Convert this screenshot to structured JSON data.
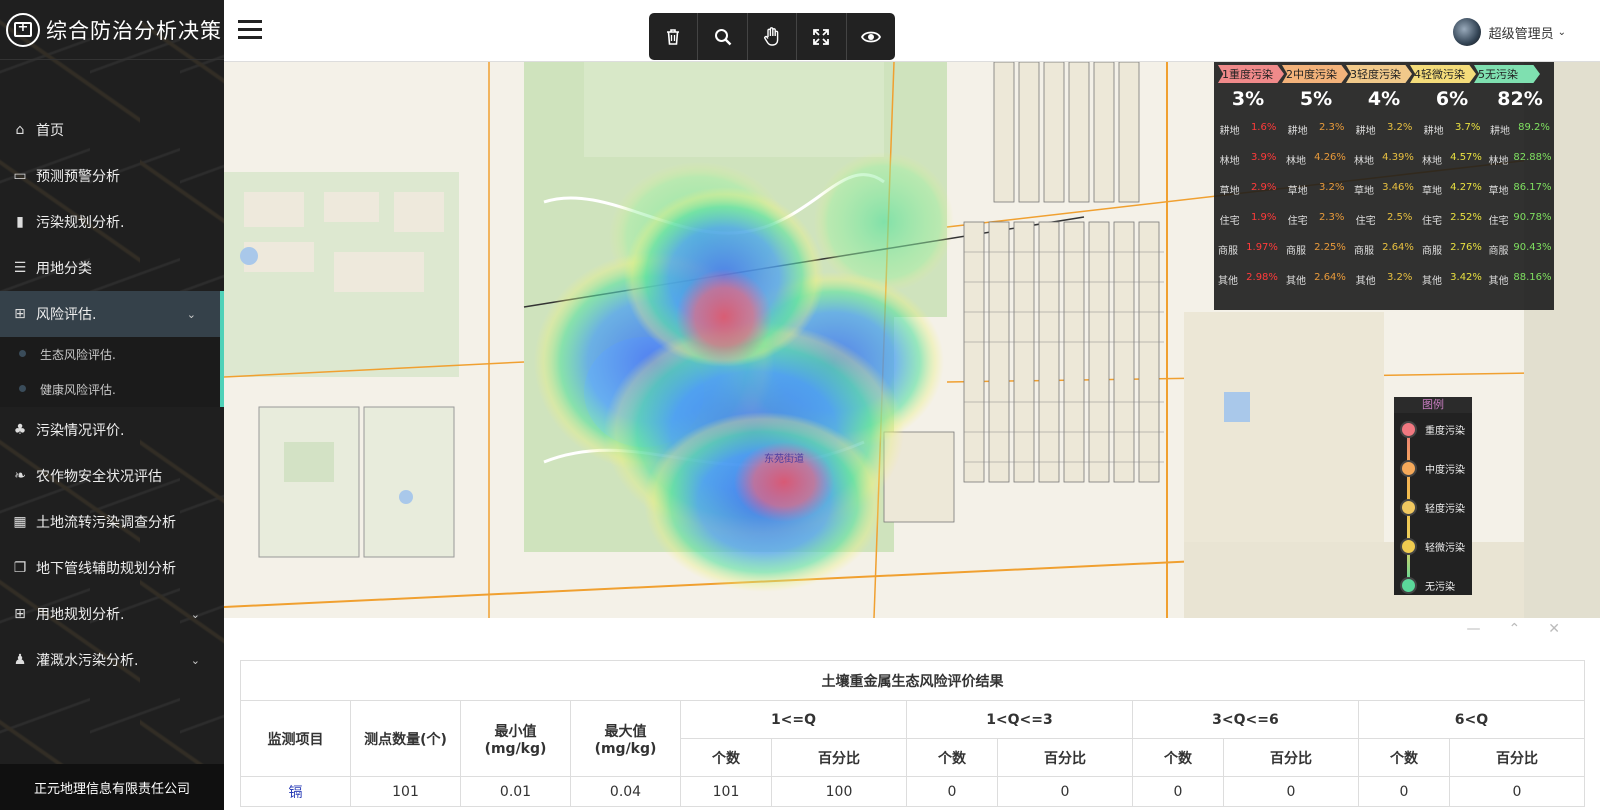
{
  "app": {
    "title": "综合防治分析决策",
    "company": "正元地理信息有限责任公司"
  },
  "sidebar": {
    "items": [
      {
        "label": "首页",
        "icon": "home-icon"
      },
      {
        "label": "预测预警分析",
        "icon": "monitor-icon"
      },
      {
        "label": "污染规划分析.",
        "icon": "bar-chart-icon"
      },
      {
        "label": "用地分类",
        "icon": "list-icon"
      },
      {
        "label": "风险评估.",
        "icon": "plus-square-icon",
        "active": true,
        "expanded": true
      },
      {
        "label": "污染情况评价.",
        "icon": "tree-icon"
      },
      {
        "label": "农作物安全状况评估",
        "icon": "leaf-icon"
      },
      {
        "label": "土地流转污染调查分析",
        "icon": "table-icon"
      },
      {
        "label": "地下管线辅助规划分析",
        "icon": "copy-icon"
      },
      {
        "label": "用地规划分析.",
        "icon": "plus-square-icon"
      },
      {
        "label": "灌溉水污染分析.",
        "icon": "person-icon"
      }
    ],
    "subitems": [
      "生态风险评估.",
      "健康风险评估."
    ]
  },
  "header": {
    "user": "超级管理员"
  },
  "toolbar": [
    "trash-icon",
    "search-icon",
    "hand-icon",
    "fullscreen-icon",
    "eye-icon"
  ],
  "stats": {
    "levels": [
      {
        "label": "1重度污染",
        "pct": "3%",
        "color": "#f08a8a"
      },
      {
        "label": "2中度污染",
        "pct": "5%",
        "color": "#f3b27a"
      },
      {
        "label": "3轻度污染",
        "pct": "4%",
        "color": "#f1c98a"
      },
      {
        "label": "4轻微污染",
        "pct": "6%",
        "color": "#f4dc7a"
      },
      {
        "label": "5无污染",
        "pct": "82%",
        "color": "#7fe0b0"
      }
    ],
    "value_colors": [
      "#ff3b3b",
      "#e89a3a",
      "#e8c040",
      "#e8e040",
      "#7fe060"
    ],
    "rows": [
      {
        "label": "耕地",
        "values": [
          "1.6%",
          "2.3%",
          "3.2%",
          "3.7%",
          "89.2%"
        ]
      },
      {
        "label": "林地",
        "values": [
          "3.9%",
          "4.26%",
          "4.39%",
          "4.57%",
          "82.88%"
        ]
      },
      {
        "label": "草地",
        "values": [
          "2.9%",
          "3.2%",
          "3.46%",
          "4.27%",
          "86.17%"
        ]
      },
      {
        "label": "住宅",
        "values": [
          "1.9%",
          "2.3%",
          "2.5%",
          "2.52%",
          "90.78%"
        ]
      },
      {
        "label": "商服",
        "values": [
          "1.97%",
          "2.25%",
          "2.64%",
          "2.76%",
          "90.43%"
        ]
      },
      {
        "label": "其他",
        "values": [
          "2.98%",
          "2.64%",
          "3.2%",
          "3.42%",
          "88.16%"
        ]
      }
    ]
  },
  "legend": {
    "title": "图例",
    "items": [
      {
        "label": "重度污染",
        "color": "#f07880"
      },
      {
        "label": "中度污染",
        "color": "#f5a95a"
      },
      {
        "label": "轻度污染",
        "color": "#f0c860"
      },
      {
        "label": "轻微污染",
        "color": "#f0cc50"
      },
      {
        "label": "无污染",
        "color": "#5bd89a"
      }
    ]
  },
  "map": {
    "street_label": "东苑街道"
  },
  "result": {
    "title": "土壤重金属生态风险评价结果",
    "headers": {
      "item": "监测项目",
      "count": "测点数量(个)",
      "min": "最小值\n(mg/kg)",
      "max": "最大值\n(mg/kg)",
      "ranges": [
        "1<=Q",
        "1<Q<=3",
        "3<Q<=6",
        "6<Q"
      ],
      "sub": [
        "个数",
        "百分比"
      ]
    },
    "rows": [
      {
        "item": "镉",
        "count": "101",
        "min": "0.01",
        "max": "0.04",
        "values": [
          "101",
          "100",
          "0",
          "0",
          "0",
          "0",
          "0",
          "0"
        ]
      }
    ]
  }
}
